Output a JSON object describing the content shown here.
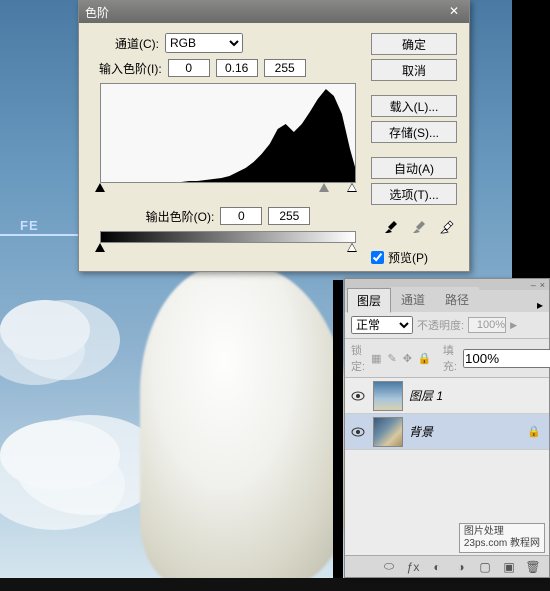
{
  "bg": {
    "fe_text": "FE"
  },
  "levels": {
    "title": "色阶",
    "channel_label": "通道(C):",
    "channel_value": "RGB",
    "input_label": "输入色阶(I):",
    "input_black": "0",
    "input_gamma": "0.16",
    "input_white": "255",
    "output_label": "输出色阶(O):",
    "output_black": "0",
    "output_white": "255",
    "buttons": {
      "ok": "确定",
      "cancel": "取消",
      "load": "载入(L)...",
      "save": "存储(S)...",
      "auto": "自动(A)",
      "options": "选项(T)..."
    },
    "preview_label": "预览(P)"
  },
  "chart_data": {
    "type": "area",
    "title": "",
    "xlabel": "",
    "ylabel": "",
    "x_range": [
      0,
      255
    ],
    "y_range": [
      0,
      100
    ],
    "series": [
      {
        "name": "histogram",
        "x": [
          0,
          8,
          16,
          24,
          32,
          40,
          48,
          56,
          64,
          72,
          80,
          88,
          96,
          104,
          112,
          120,
          128,
          136,
          144,
          152,
          160,
          168,
          176,
          184,
          192,
          200,
          208,
          216,
          224,
          232,
          240,
          248,
          255
        ],
        "values": [
          0,
          0,
          0,
          0,
          1,
          1,
          1,
          1,
          2,
          2,
          2,
          3,
          3,
          4,
          5,
          6,
          8,
          12,
          16,
          22,
          30,
          40,
          55,
          60,
          52,
          60,
          72,
          85,
          95,
          88,
          70,
          35,
          10
        ]
      }
    ]
  },
  "panel": {
    "tabs": {
      "layers": "图层",
      "channels": "通道",
      "paths": "路径"
    },
    "blend_mode": "正常",
    "opacity_label": "不透明度:",
    "opacity_value": "100%",
    "lock_label": "锁定:",
    "fill_label": "填充:",
    "fill_value": "100%",
    "layers_list": [
      {
        "name": "图层 1",
        "locked": false
      },
      {
        "name": "背景",
        "locked": true
      }
    ],
    "watermark_line1": "图片处理",
    "watermark_line2": "23ps.com 教程网"
  }
}
